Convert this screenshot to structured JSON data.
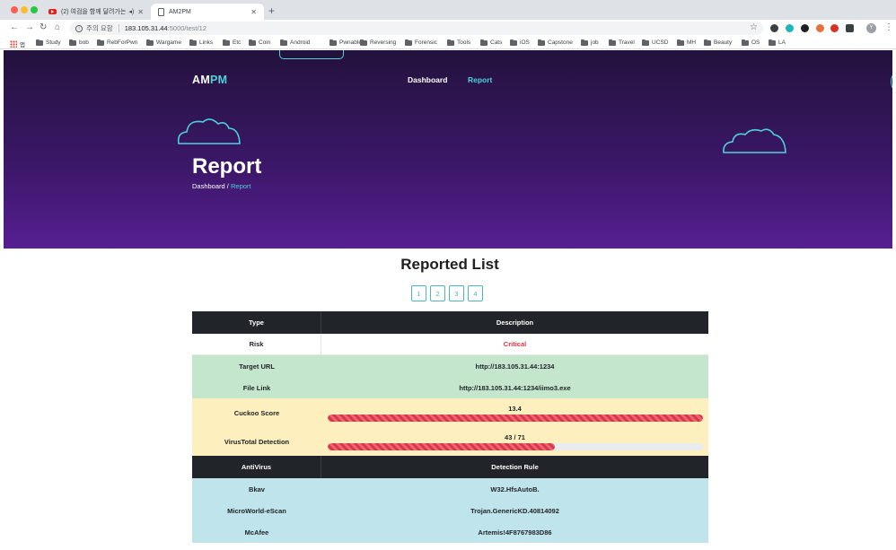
{
  "browser": {
    "tabs": [
      {
        "title": "(2) 여검을 함께 달려가는 노드..."
      },
      {
        "title": "AM2PM"
      }
    ],
    "address": {
      "security_label": "주의 요함",
      "host": "183.105.31.44",
      "path": ":5000/test/12"
    },
    "bookmarks": [
      "앱",
      "Study",
      "bob",
      "RebForPwn",
      "Wargame",
      "Links",
      "Etc",
      "Coin",
      "Android",
      "Pwnable",
      "Reversing",
      "Forensic",
      "Tools",
      "Cats",
      "iOS",
      "Capstone",
      "job",
      "Travel",
      "UCSD",
      "MH",
      "Beauty",
      "OS",
      "LA"
    ],
    "extension_colors": [
      "#3c4043",
      "#1bb6b8",
      "#202124",
      "#e8703a",
      "#d93025",
      "#3c4043"
    ],
    "profile_initial": "Y"
  },
  "site": {
    "brand_prefix": "AM",
    "brand_suffix": "PM",
    "nav": {
      "dashboard": "Dashboard",
      "report": "Report"
    },
    "hero_title": "Report",
    "breadcrumb": {
      "home": "Dashboard",
      "separator": "/",
      "current": "Report"
    },
    "accent_color": "#4fd1d9"
  },
  "report": {
    "section_title": "Reported List",
    "pages": [
      "1",
      "2",
      "3",
      "4"
    ],
    "header": {
      "col1": "Type",
      "col2": "Description"
    },
    "risk": {
      "label": "Risk",
      "value": "Critical"
    },
    "target_url": {
      "label": "Target URL",
      "value": "http://183.105.31.44:1234"
    },
    "file_link": {
      "label": "File Link",
      "value": "http://183.105.31.44:1234/iimo3.exe"
    },
    "cuckoo": {
      "label": "Cuckoo Score",
      "value_text": "13.4",
      "fraction": 1.0
    },
    "virustotal": {
      "label": "VirusTotal Detection",
      "value_text": "43 / 71",
      "fraction": 0.6056
    },
    "av_header": {
      "col1": "AntiVirus",
      "col2": "Detection Rule"
    },
    "av_rows": [
      {
        "engine": "Bkav",
        "rule": "W32.HfsAutoB."
      },
      {
        "engine": "MicroWorld-eScan",
        "rule": "Trojan.GenericKD.40814092"
      },
      {
        "engine": "McAfee",
        "rule": "Artemis!4F8767983D86"
      }
    ]
  }
}
